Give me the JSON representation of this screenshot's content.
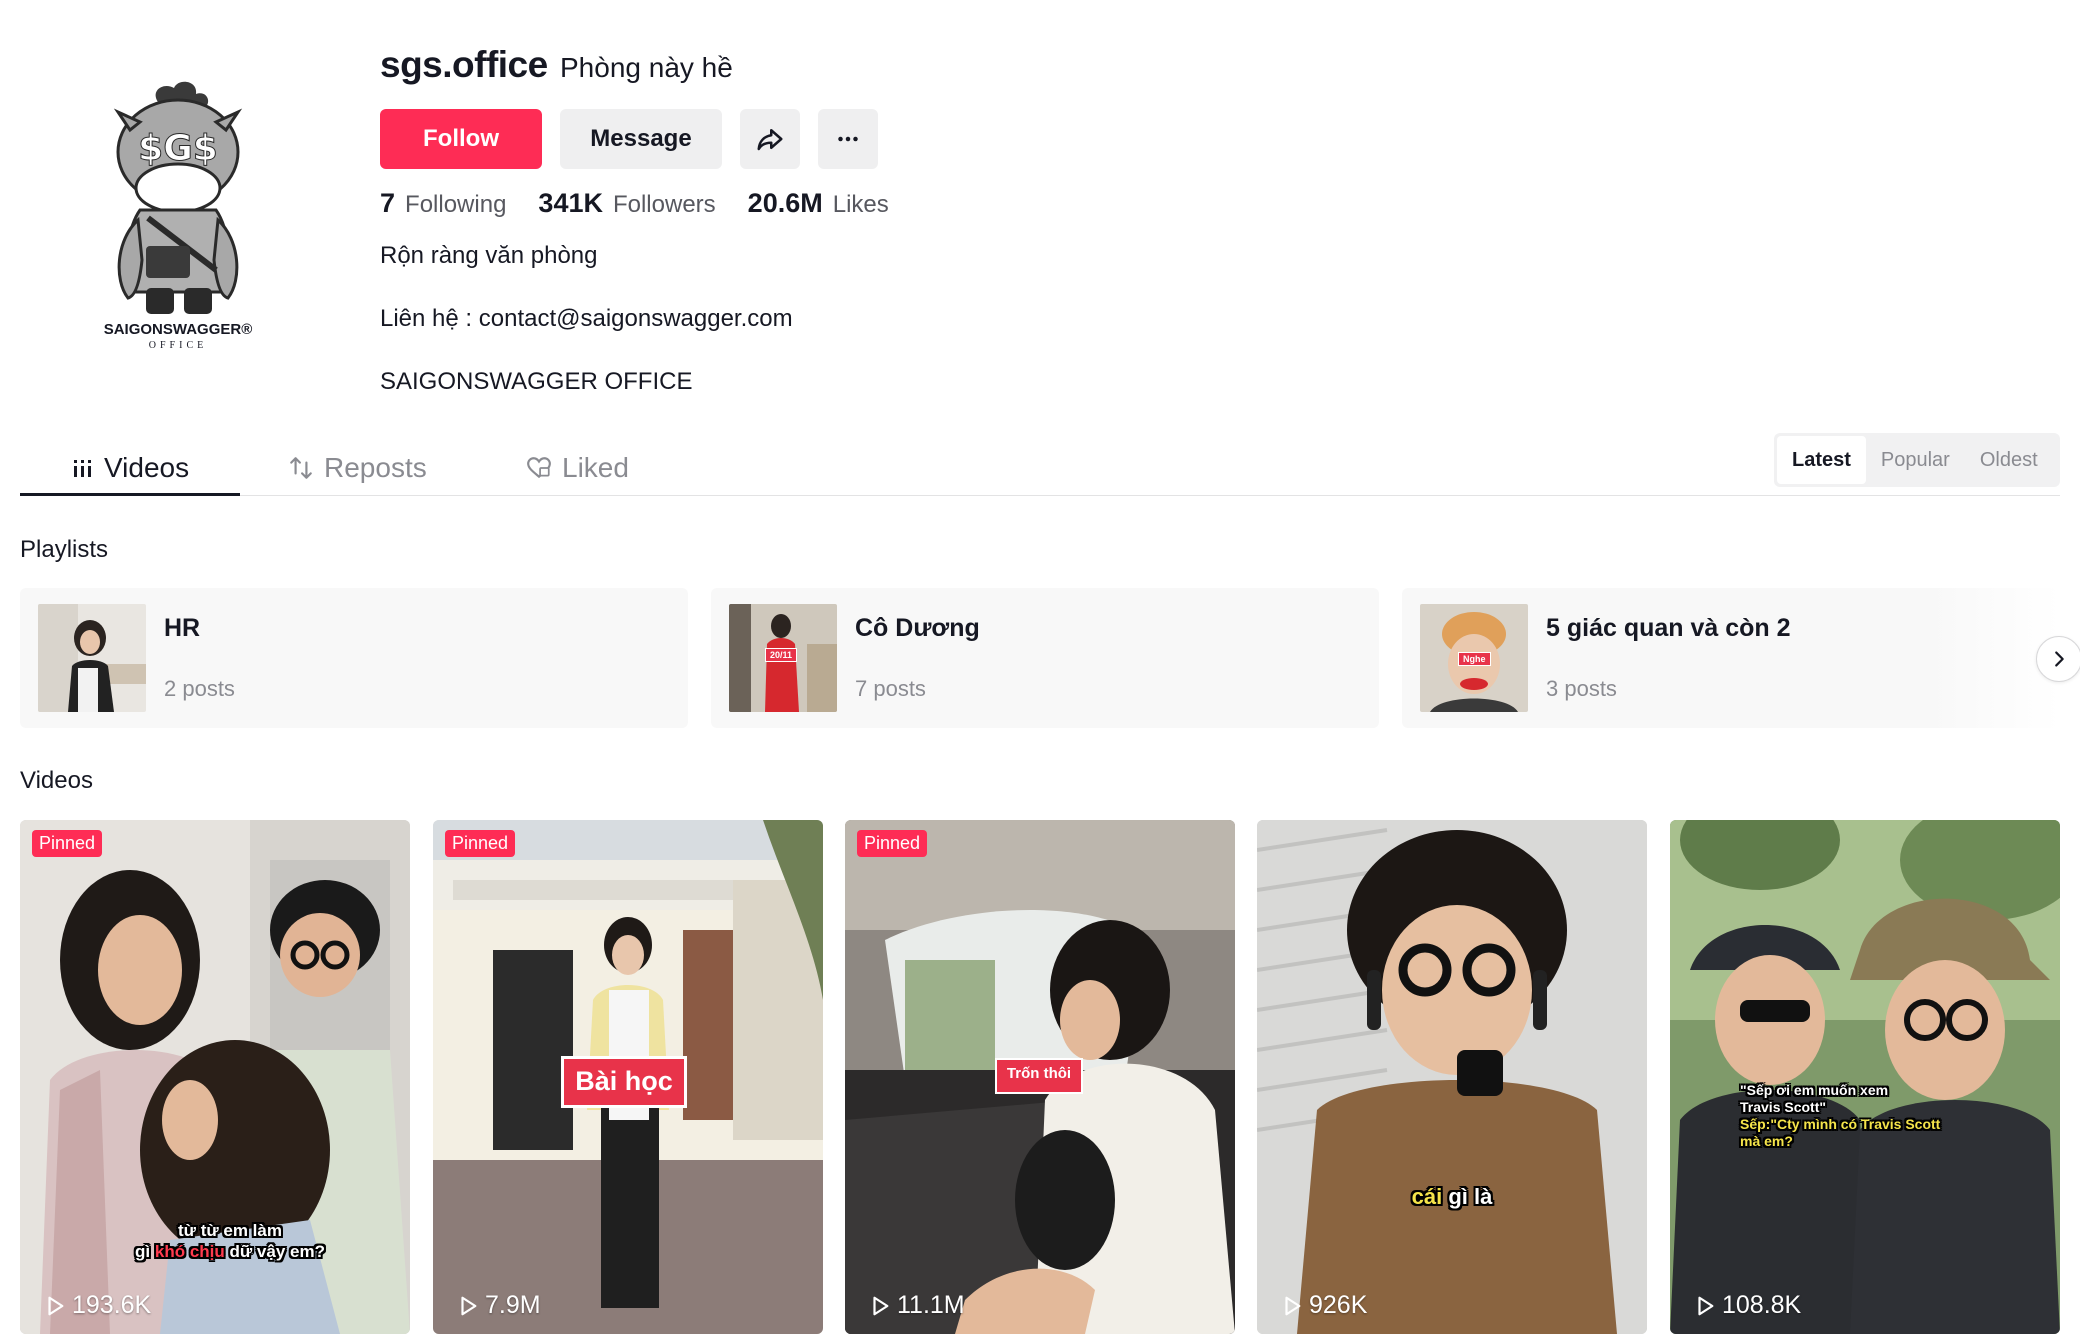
{
  "profile": {
    "username": "sgs.office",
    "nickname": "Phòng này hề",
    "avatar_brand": "SAIGONSWAGGER®",
    "avatar_sub": "OFFICE",
    "avatar_emblem": "$G$",
    "follow_label": "Follow",
    "message_label": "Message",
    "share_icon": "share-icon",
    "more_icon": "more-icon",
    "stats": {
      "following_count": "7",
      "following_label": "Following",
      "followers_count": "341K",
      "followers_label": "Followers",
      "likes_count": "20.6M",
      "likes_label": "Likes"
    },
    "bio": {
      "line1": "Rộn ràng văn phòng",
      "line2": "Liên hệ : contact@saigonswagger.com",
      "line3": "SAIGONSWAGGER OFFICE"
    }
  },
  "tabs": {
    "videos": "Videos",
    "reposts": "Reposts",
    "liked": "Liked",
    "active": "Videos"
  },
  "sort": {
    "options": [
      "Latest",
      "Popular",
      "Oldest"
    ],
    "selected": "Latest"
  },
  "sections": {
    "playlists_title": "Playlists",
    "videos_title": "Videos"
  },
  "playlists": [
    {
      "name": "HR",
      "count": "2 posts"
    },
    {
      "name": "Cô Dương",
      "count": "7 posts",
      "thumb_sticker": "20/11"
    },
    {
      "name": "5 giác quan và còn 2",
      "count": "3 posts",
      "thumb_sticker": "Nghe"
    }
  ],
  "videos": [
    {
      "pinned": "Pinned",
      "views": "193.6K",
      "caption_line1": "từ từ em làm",
      "caption_pre": "gì ",
      "caption_red": "khó chịu",
      "caption_post": " dữ vậy em?"
    },
    {
      "pinned": "Pinned",
      "views": "7.9M",
      "sticker": "Bài học"
    },
    {
      "pinned": "Pinned",
      "views": "11.1M",
      "sticker": "Trốn thôi"
    },
    {
      "views": "926K",
      "caption_yellow": "cái",
      "caption_rest": " gì là"
    },
    {
      "views": "108.8K",
      "caption_line1": "\"Sếp ơi em muốn xem",
      "caption_line2": "Travis Scott\"",
      "caption_yellow1": "Sếp:\"Cty mình có Travis Scott",
      "caption_yellow2": "mà em?"
    }
  ],
  "pinned_label": "Pinned",
  "colors": {
    "accent": "#fe2c55",
    "button_gray": "#efeff0",
    "text_primary": "#161823",
    "text_secondary": "#8a8b91"
  }
}
